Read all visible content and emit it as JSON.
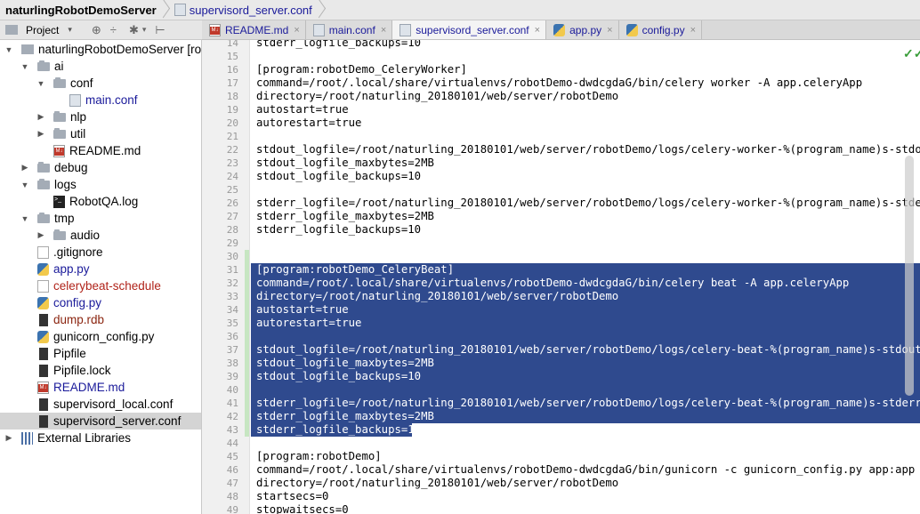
{
  "breadcrumb": {
    "root": "naturlingRobotDemoServer",
    "file": "supervisord_server.conf"
  },
  "project_toolbar": {
    "label": "Project",
    "caret": "▾",
    "sync_icon": "⊕",
    "collapse_icon": "÷",
    "gear_icon": "✱",
    "hide_icon": "⊢"
  },
  "tabs": [
    {
      "label": "README.md",
      "icon": "md",
      "close": "×"
    },
    {
      "label": "main.conf",
      "icon": "conf",
      "close": "×"
    },
    {
      "label": "supervisord_server.conf",
      "icon": "conf",
      "close": "×"
    },
    {
      "label": "app.py",
      "icon": "py",
      "close": "×"
    },
    {
      "label": "config.py",
      "icon": "py",
      "close": "×"
    }
  ],
  "tree": [
    {
      "label": "naturlingRobotDemoServer [ro",
      "arrow": "▼",
      "icon": "proj",
      "depth": 0,
      "color": "normal",
      "bold": true
    },
    {
      "label": "ai",
      "arrow": "▼",
      "icon": "folder",
      "depth": 1,
      "color": "normal"
    },
    {
      "label": "conf",
      "arrow": "▼",
      "icon": "folder",
      "depth": 2,
      "color": "normal"
    },
    {
      "label": "main.conf",
      "arrow": "",
      "icon": "conf",
      "depth": 3,
      "color": "blue"
    },
    {
      "label": "nlp",
      "arrow": "▶",
      "icon": "folder",
      "depth": 2,
      "color": "normal"
    },
    {
      "label": "util",
      "arrow": "▶",
      "icon": "folder",
      "depth": 2,
      "color": "normal"
    },
    {
      "label": "README.md",
      "arrow": "",
      "icon": "md",
      "depth": 2,
      "color": "normal"
    },
    {
      "label": "debug",
      "arrow": "▶",
      "icon": "folder",
      "depth": 1,
      "color": "normal"
    },
    {
      "label": "logs",
      "arrow": "▼",
      "icon": "folder",
      "depth": 1,
      "color": "normal"
    },
    {
      "label": "RobotQA.log",
      "arrow": "",
      "icon": "log",
      "depth": 2,
      "color": "normal"
    },
    {
      "label": "tmp",
      "arrow": "▼",
      "icon": "folder",
      "depth": 1,
      "color": "normal"
    },
    {
      "label": "audio",
      "arrow": "▶",
      "icon": "folder",
      "depth": 2,
      "color": "normal"
    },
    {
      "label": ".gitignore",
      "arrow": "",
      "icon": "txt",
      "depth": 1,
      "color": "normal"
    },
    {
      "label": "app.py",
      "arrow": "",
      "icon": "py",
      "depth": 1,
      "color": "blue"
    },
    {
      "label": "celerybeat-schedule",
      "arrow": "",
      "icon": "txt",
      "depth": 1,
      "color": "red"
    },
    {
      "label": "config.py",
      "arrow": "",
      "icon": "py",
      "depth": 1,
      "color": "blue"
    },
    {
      "label": "dump.rdb",
      "arrow": "",
      "icon": "db",
      "depth": 1,
      "color": "brown"
    },
    {
      "label": "gunicorn_config.py",
      "arrow": "",
      "icon": "py",
      "depth": 1,
      "color": "normal"
    },
    {
      "label": "Pipfile",
      "arrow": "",
      "icon": "db",
      "depth": 1,
      "color": "normal"
    },
    {
      "label": "Pipfile.lock",
      "arrow": "",
      "icon": "db",
      "depth": 1,
      "color": "normal"
    },
    {
      "label": "README.md",
      "arrow": "",
      "icon": "md",
      "depth": 1,
      "color": "blue"
    },
    {
      "label": "supervisord_local.conf",
      "arrow": "",
      "icon": "db",
      "depth": 1,
      "color": "normal"
    },
    {
      "label": "supervisord_server.conf",
      "arrow": "",
      "icon": "db",
      "depth": 1,
      "color": "normal",
      "selected": true
    },
    {
      "label": "External Libraries",
      "arrow": "▶",
      "icon": "libs",
      "depth": 0,
      "color": "normal"
    }
  ],
  "editor": {
    "inspection_icon": "✓✓",
    "lines": [
      {
        "n": "14",
        "text": "stderr_logfile_backups=10",
        "sel": false
      },
      {
        "n": "15",
        "text": "",
        "sel": false
      },
      {
        "n": "16",
        "text": "[program:robotDemo_CeleryWorker]",
        "sel": false
      },
      {
        "n": "17",
        "text": "command=/root/.local/share/virtualenvs/robotDemo-dwdcgdaG/bin/celery worker -A app.celeryApp",
        "sel": false
      },
      {
        "n": "18",
        "text": "directory=/root/naturling_20180101/web/server/robotDemo",
        "sel": false
      },
      {
        "n": "19",
        "text": "autostart=true",
        "sel": false
      },
      {
        "n": "20",
        "text": "autorestart=true",
        "sel": false
      },
      {
        "n": "21",
        "text": "",
        "sel": false
      },
      {
        "n": "22",
        "text": "stdout_logfile=/root/naturling_20180101/web/server/robotDemo/logs/celery-worker-%(program_name)s-stdout.log",
        "sel": false
      },
      {
        "n": "23",
        "text": "stdout_logfile_maxbytes=2MB",
        "sel": false
      },
      {
        "n": "24",
        "text": "stdout_logfile_backups=10",
        "sel": false
      },
      {
        "n": "25",
        "text": "",
        "sel": false
      },
      {
        "n": "26",
        "text": "stderr_logfile=/root/naturling_20180101/web/server/robotDemo/logs/celery-worker-%(program_name)s-stderr.log",
        "sel": false
      },
      {
        "n": "27",
        "text": "stderr_logfile_maxbytes=2MB",
        "sel": false
      },
      {
        "n": "28",
        "text": "stderr_logfile_backups=10",
        "sel": false
      },
      {
        "n": "29",
        "text": "",
        "sel": false
      },
      {
        "n": "30",
        "text": "",
        "sel": false
      },
      {
        "n": "31",
        "text": "[program:robotDemo_CeleryBeat]",
        "sel": true
      },
      {
        "n": "32",
        "text": "command=/root/.local/share/virtualenvs/robotDemo-dwdcgdaG/bin/celery beat -A app.celeryApp",
        "sel": true
      },
      {
        "n": "33",
        "text": "directory=/root/naturling_20180101/web/server/robotDemo",
        "sel": true
      },
      {
        "n": "34",
        "text": "autostart=true",
        "sel": true
      },
      {
        "n": "35",
        "text": "autorestart=true",
        "sel": true
      },
      {
        "n": "36",
        "text": "",
        "sel": true
      },
      {
        "n": "37",
        "text": "stdout_logfile=/root/naturling_20180101/web/server/robotDemo/logs/celery-beat-%(program_name)s-stdout.log",
        "sel": true
      },
      {
        "n": "38",
        "text": "stdout_logfile_maxbytes=2MB",
        "sel": true
      },
      {
        "n": "39",
        "text": "stdout_logfile_backups=10",
        "sel": true
      },
      {
        "n": "40",
        "text": "",
        "sel": true
      },
      {
        "n": "41",
        "text": "stderr_logfile=/root/naturling_20180101/web/server/robotDemo/logs/celery-beat-%(program_name)s-stderr.log",
        "sel": true
      },
      {
        "n": "42",
        "text": "stderr_logfile_maxbytes=2MB",
        "sel": true
      },
      {
        "n": "43",
        "text": "stderr_logfile_backups=10",
        "sel": true
      },
      {
        "n": "44",
        "text": "",
        "sel": false
      },
      {
        "n": "45",
        "text": "[program:robotDemo]",
        "sel": false
      },
      {
        "n": "46",
        "text": "command=/root/.local/share/virtualenvs/robotDemo-dwdcgdaG/bin/gunicorn -c gunicorn_config.py app:app",
        "sel": false
      },
      {
        "n": "47",
        "text": "directory=/root/naturling_20180101/web/server/robotDemo",
        "sel": false
      },
      {
        "n": "48",
        "text": "startsecs=0",
        "sel": false
      },
      {
        "n": "49",
        "text": "stopwaitsecs=0",
        "sel": false
      }
    ]
  }
}
